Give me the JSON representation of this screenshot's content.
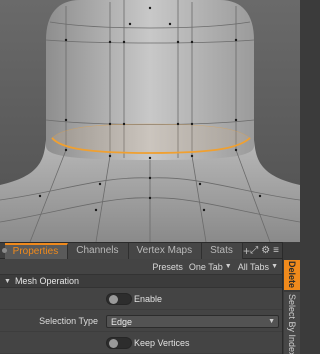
{
  "tabs": [
    {
      "label": "Properties",
      "active": true
    },
    {
      "label": "Channels",
      "active": false
    },
    {
      "label": "Vertex Maps",
      "active": false
    },
    {
      "label": "Stats",
      "active": false
    }
  ],
  "tab_add_label": "+",
  "tabbar_tools": {
    "expand_icon": "expand-icon",
    "gear_icon": "gear-icon",
    "menu_icon": "menu-icon"
  },
  "panel": {
    "presets_label": "Presets",
    "one_tab": "One Tab",
    "all_tabs": "All Tabs",
    "section_title": "Mesh Operation",
    "enable": {
      "label": "Enable",
      "on": false
    },
    "selection_type": {
      "label": "Selection Type",
      "value": "Edge"
    },
    "keep_vertices": {
      "label": "Keep Vertices",
      "on": false
    }
  },
  "sidebar": {
    "delete_label": "Delete",
    "select_by_index_label": "Select By Index"
  },
  "colors": {
    "accent": "#f08a1c",
    "selected_edge": "#f0a030"
  }
}
